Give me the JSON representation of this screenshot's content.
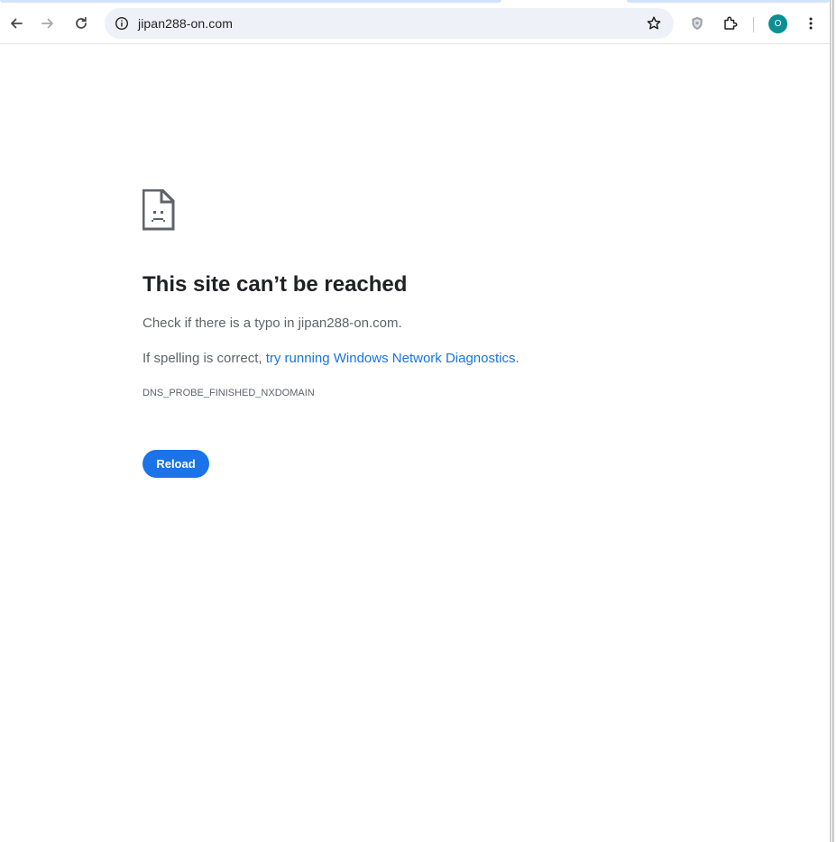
{
  "browser": {
    "url": "jipan288-on.com",
    "avatar_initial": "O",
    "avatar_color": "#0a8f93",
    "accent_color": "#1a73e8",
    "icons": {
      "back": "arrow-left-icon",
      "forward": "arrow-right-icon",
      "reload": "refresh-icon",
      "site_info": "info-circle-icon",
      "bookmark": "star-icon",
      "shield": "shield-icon",
      "extensions": "puzzle-icon",
      "menu": "kebab-menu-icon"
    }
  },
  "error_page": {
    "icon": "sad-document-icon",
    "title": "This site can’t be reached",
    "typo_message": "Check if there is a typo in jipan288-on.com.",
    "diagnostics_prefix": "If spelling is correct, ",
    "diagnostics_link": "try running Windows Network Diagnostics",
    "diagnostics_suffix": ".",
    "error_code": "DNS_PROBE_FINISHED_NXDOMAIN",
    "reload_label": "Reload"
  }
}
